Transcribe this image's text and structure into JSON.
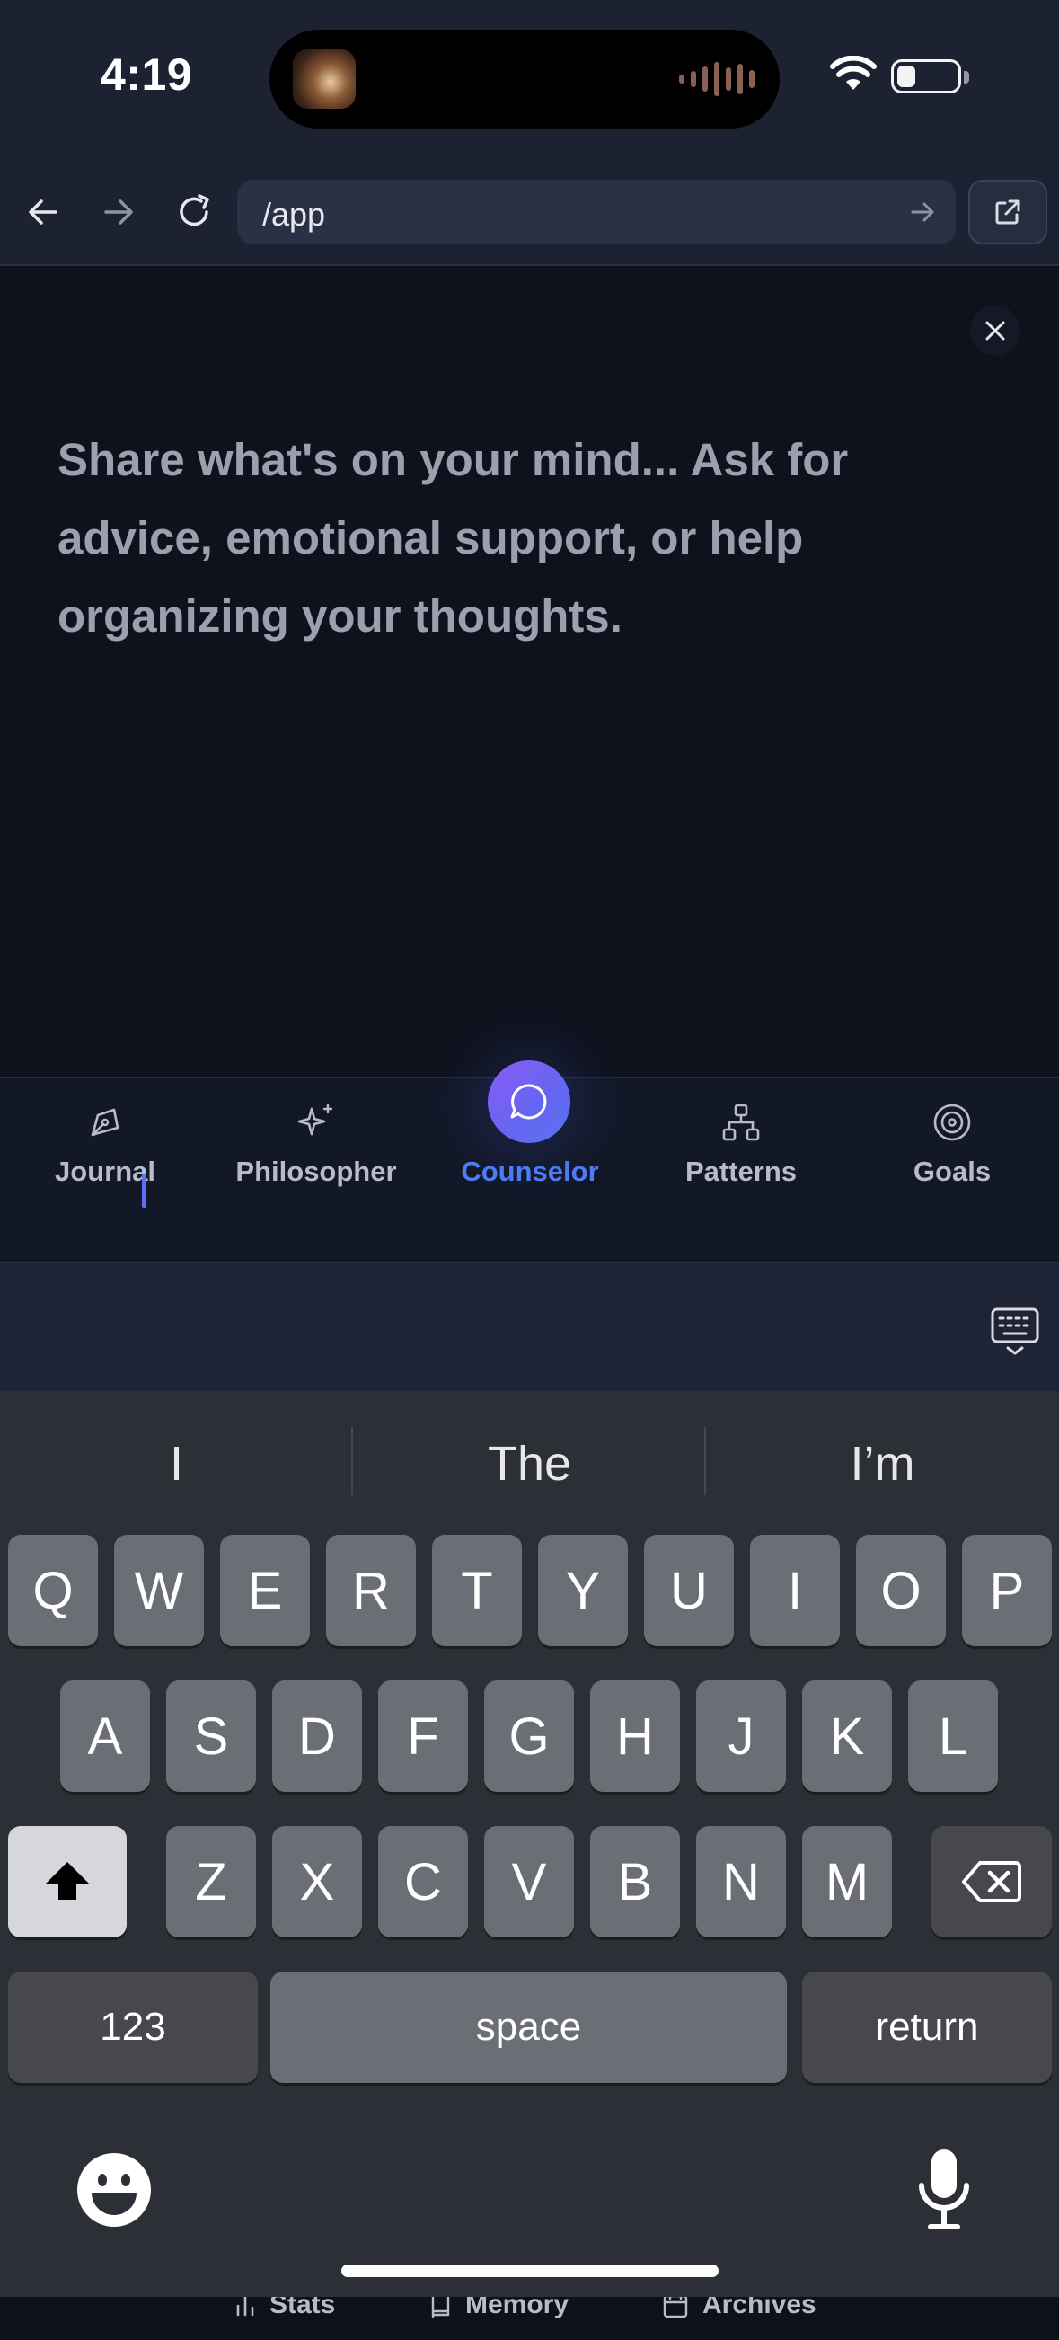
{
  "status_bar": {
    "time": "4:19",
    "icons": [
      "now-playing-thumbnail",
      "audio-waveform-icon",
      "wifi-icon",
      "battery-icon"
    ]
  },
  "browser": {
    "url": "/app",
    "buttons": [
      "back-icon",
      "forward-icon",
      "reload-icon",
      "go-arrow-icon",
      "open-external-icon"
    ]
  },
  "main": {
    "prompt": "Share what's on your mind... Ask for advice, emotional support, or help organizing your thoughts."
  },
  "tabs": [
    {
      "label": "Journal",
      "icon": "pen-nib-icon"
    },
    {
      "label": "Philosopher",
      "icon": "sparkles-icon"
    },
    {
      "label": "Counselor",
      "icon": "chat-bubble-icon",
      "active": true
    },
    {
      "label": "Patterns",
      "icon": "hierarchy-icon"
    },
    {
      "label": "Goals",
      "icon": "target-icon"
    }
  ],
  "subtabs": [
    {
      "label": "Stats",
      "icon": "bar-chart-icon"
    },
    {
      "label": "Memory",
      "icon": "book-icon"
    },
    {
      "label": "Archives",
      "icon": "calendar-icon"
    }
  ],
  "keyboard": {
    "suggestions": [
      "I",
      "The",
      "I’m"
    ],
    "row1": [
      "Q",
      "W",
      "E",
      "R",
      "T",
      "Y",
      "U",
      "I",
      "O",
      "P"
    ],
    "row2": [
      "A",
      "S",
      "D",
      "F",
      "G",
      "H",
      "J",
      "K",
      "L"
    ],
    "row3": [
      "Z",
      "X",
      "C",
      "V",
      "B",
      "N",
      "M"
    ],
    "numbers_label": "123",
    "space_label": "space",
    "return_label": "return"
  },
  "colors": {
    "accent": "#4f7cf6",
    "background": "#0e121c",
    "bar": "#1c2232",
    "keyboard": "#2c2f36"
  }
}
